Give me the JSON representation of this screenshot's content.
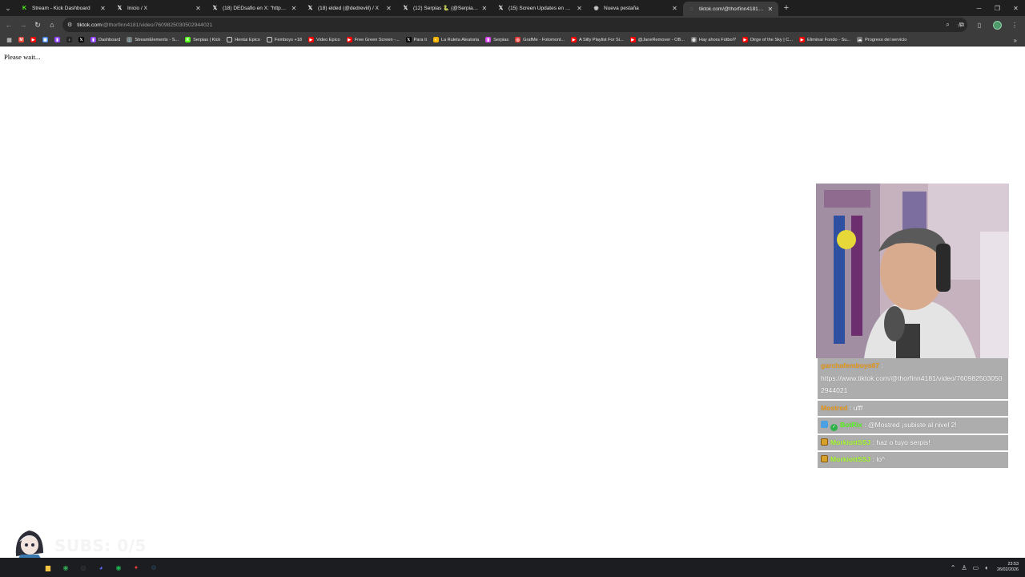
{
  "browser": {
    "tabs": [
      {
        "title": "Stream - Kick Dashboard",
        "icon": "kick-icon",
        "color": "#53fc18",
        "glyph": "K",
        "active": false
      },
      {
        "title": "Inicio / X",
        "icon": "x-icon",
        "color": "#ffffff",
        "glyph": "𝕏",
        "active": false
      },
      {
        "title": "(18) DEDsafio en X: \"https://t.co",
        "icon": "x-icon",
        "color": "#ffffff",
        "glyph": "𝕏",
        "active": false
      },
      {
        "title": "(18) elded (@dedreviil) / X",
        "icon": "x-icon",
        "color": "#ffffff",
        "glyph": "𝕏",
        "active": false
      },
      {
        "title": "(12) Serpias 🐍 (@Serpias) / X",
        "icon": "x-icon",
        "color": "#ffffff",
        "glyph": "𝕏",
        "active": false
      },
      {
        "title": "(15) Screen Updates en X: \"",
        "icon": "x-icon",
        "color": "#ffffff",
        "glyph": "𝕏",
        "active": false
      },
      {
        "title": "Nueva pestaña",
        "icon": "chrome-icon",
        "color": "#cfcfcf",
        "glyph": "◉",
        "active": false
      },
      {
        "title": "tiktok.com/@thorfinn4181/vide",
        "icon": "loading-icon",
        "color": "#9a9a9a",
        "glyph": "◌",
        "active": true
      }
    ],
    "new_tab_glyph": "+",
    "url_host": "tiktok.com",
    "url_path": "/@thorfinn4181/video/7609825030502944021"
  },
  "bookmarks": [
    {
      "label": "",
      "icon": "gmail-icon",
      "color": "#ea4335",
      "glyph": "M"
    },
    {
      "label": "",
      "icon": "youtube-icon",
      "color": "#ff0000",
      "glyph": "▶"
    },
    {
      "label": "",
      "icon": "apps-icon",
      "color": "#4285f4",
      "glyph": "▦"
    },
    {
      "label": "",
      "icon": "twitch-icon",
      "color": "#9146ff",
      "glyph": "▮"
    },
    {
      "label": "",
      "icon": "tiktok-icon",
      "color": "#222222",
      "glyph": "♪"
    },
    {
      "label": "",
      "icon": "x-icon",
      "color": "#000000",
      "glyph": "𝕏"
    },
    {
      "label": "Dashboard",
      "icon": "twitch-icon",
      "color": "#9146ff",
      "glyph": "▮"
    },
    {
      "label": "StreamElements - S...",
      "icon": "streamelements-icon",
      "color": "#7a7a7a",
      "glyph": "⚓"
    },
    {
      "label": "Serpias | Kick",
      "icon": "kick-icon",
      "color": "#53fc18",
      "glyph": "K"
    },
    {
      "label": "Hentai Epico",
      "icon": "folder-icon",
      "color": "#3c3c3c",
      "glyph": "▭"
    },
    {
      "label": "Femboys +18",
      "icon": "folder-icon",
      "color": "#3c3c3c",
      "glyph": "▭"
    },
    {
      "label": "Video Epico",
      "icon": "youtube-icon",
      "color": "#ff0000",
      "glyph": "▶"
    },
    {
      "label": "Free Green Screen -...",
      "icon": "youtube-icon",
      "color": "#ff0000",
      "glyph": "▶"
    },
    {
      "label": "Para ti",
      "icon": "x-icon",
      "color": "#000000",
      "glyph": "𝕏"
    },
    {
      "label": "La Ruleta Aleatoria",
      "icon": "wheel-icon",
      "color": "#f4b400",
      "glyph": "◐"
    },
    {
      "label": "Serpias",
      "icon": "twitch-icon",
      "color": "#d946ef",
      "glyph": "▮"
    },
    {
      "label": "GrafMe - Fotomont...",
      "icon": "grafme-icon",
      "color": "#e53935",
      "glyph": "◎"
    },
    {
      "label": "A Silly Playlist For Si...",
      "icon": "youtube-icon",
      "color": "#ff0000",
      "glyph": "▶"
    },
    {
      "label": "@JaneRemover - OB...",
      "icon": "youtube-icon",
      "color": "#ff0000",
      "glyph": "▶"
    },
    {
      "label": "Hay ahora Fútbol?",
      "icon": "globe-icon",
      "color": "#7a7a7a",
      "glyph": "◍"
    },
    {
      "label": "Dirge of the Sky | C...",
      "icon": "youtube-icon",
      "color": "#ff0000",
      "glyph": "▶"
    },
    {
      "label": "Eliminar Fondo - Su...",
      "icon": "youtube-icon",
      "color": "#ff0000",
      "glyph": "▶"
    },
    {
      "label": "Progreso del servicio",
      "icon": "service-icon",
      "color": "#7a7a7a",
      "glyph": "☁"
    }
  ],
  "page": {
    "loading_text": "Please wait..."
  },
  "chat": [
    {
      "user": "garchafemboys67",
      "sep": ":",
      "text": "https://www.tiktok.com/@thorfinn4181/video/7609825030502944021",
      "user_class": "u-orange",
      "badges": []
    },
    {
      "user": "Mostred",
      "sep": ":",
      "text": "ufff",
      "user_class": "u-orange",
      "badges": []
    },
    {
      "user": "BotRix",
      "sep": ":",
      "text": "@Mostred ¡subiste al nivel 2!",
      "user_class": "u-green",
      "badges": [
        "bot",
        "verified"
      ]
    },
    {
      "user": "MorkiottSSJ",
      "sep": ":",
      "text": "haz o tuyo serpis!",
      "user_class": "u-bright",
      "badges": [
        "sub"
      ]
    },
    {
      "user": "MorkiottSSJ",
      "sep": ":",
      "text": "lo^",
      "user_class": "u-bright",
      "badges": [
        "sub"
      ]
    }
  ],
  "subs_overlay": {
    "text": "SUBS: 0/5"
  },
  "taskbar": {
    "time": "23:53",
    "date": "26/02/2026",
    "apps": [
      {
        "icon": "file-explorer-icon",
        "color": "#f4c542",
        "glyph": "▆"
      },
      {
        "icon": "chrome-icon",
        "color": "#34a853",
        "glyph": "◉"
      },
      {
        "icon": "obs-icon",
        "color": "#444444",
        "glyph": "◎"
      },
      {
        "icon": "discord-icon",
        "color": "#5865f2",
        "glyph": "◕"
      },
      {
        "icon": "spotify-icon",
        "color": "#1db954",
        "glyph": "◉"
      },
      {
        "icon": "app-icon",
        "color": "#e53935",
        "glyph": "✦"
      },
      {
        "icon": "steam-icon",
        "color": "#2a475e",
        "glyph": "⚙"
      }
    ]
  }
}
